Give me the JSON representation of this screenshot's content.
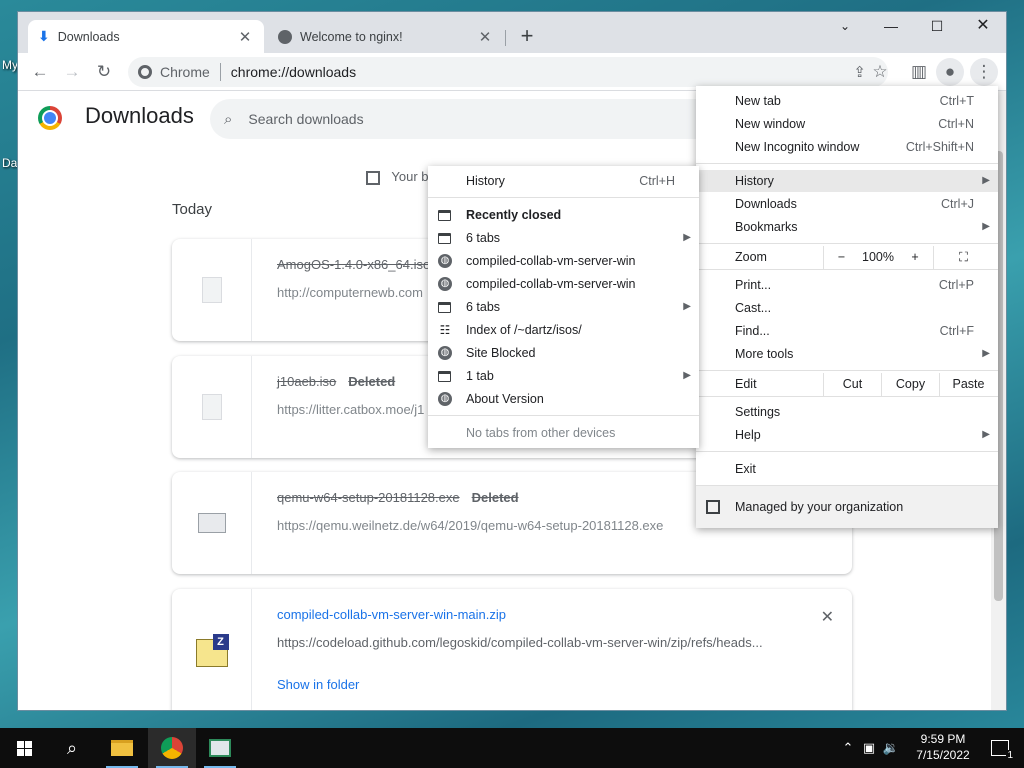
{
  "desktop": {
    "labels": [
      "My",
      "Da"
    ]
  },
  "browser": {
    "tabs": [
      {
        "title": "Downloads",
        "icon": "download-icon",
        "active": true
      },
      {
        "title": "Welcome to nginx!",
        "icon": "globe-icon",
        "active": false
      }
    ],
    "omnibox": {
      "scheme": "Chrome",
      "url": "chrome://downloads"
    }
  },
  "downloads_page": {
    "title": "Downloads",
    "search_placeholder": "Search downloads",
    "managed_notice": "Your b",
    "section_label": "Today",
    "items": [
      {
        "name": "AmogOS-1.4.0-x86_64.iso",
        "status": "",
        "url": "http://computernewb.com",
        "deleted": true
      },
      {
        "name": "j10aeb.iso",
        "status": "Deleted",
        "url": "https://litter.catbox.moe/j1",
        "deleted": true
      },
      {
        "name": "qemu-w64-setup-20181128.exe",
        "status": "Deleted",
        "url": "https://qemu.weilnetz.de/w64/2019/qemu-w64-setup-20181128.exe",
        "deleted": true
      },
      {
        "name": "compiled-collab-vm-server-win-main.zip",
        "status": "",
        "url": "https://codeload.github.com/legoskid/compiled-collab-vm-server-win/zip/refs/heads...",
        "deleted": false,
        "action": "Show in folder"
      }
    ]
  },
  "chrome_menu": {
    "new_tab": {
      "label": "New tab",
      "shortcut": "Ctrl+T"
    },
    "new_window": {
      "label": "New window",
      "shortcut": "Ctrl+N"
    },
    "new_incognito": {
      "label": "New Incognito window",
      "shortcut": "Ctrl+Shift+N"
    },
    "history": {
      "label": "History"
    },
    "downloads": {
      "label": "Downloads",
      "shortcut": "Ctrl+J"
    },
    "bookmarks": {
      "label": "Bookmarks"
    },
    "zoom": {
      "label": "Zoom",
      "minus": "−",
      "value": "100%",
      "plus": "+"
    },
    "print": {
      "label": "Print...",
      "shortcut": "Ctrl+P"
    },
    "cast": {
      "label": "Cast..."
    },
    "find": {
      "label": "Find...",
      "shortcut": "Ctrl+F"
    },
    "more_tools": {
      "label": "More tools"
    },
    "edit": {
      "label": "Edit",
      "cut": "Cut",
      "copy": "Copy",
      "paste": "Paste"
    },
    "settings": {
      "label": "Settings"
    },
    "help": {
      "label": "Help"
    },
    "exit": {
      "label": "Exit"
    },
    "managed": {
      "label": "Managed by your organization"
    }
  },
  "history_submenu": {
    "history": {
      "label": "History",
      "shortcut": "Ctrl+H"
    },
    "recently_closed": "Recently closed",
    "items": [
      {
        "label": "6 tabs",
        "icon": "window-icon",
        "submenu": true
      },
      {
        "label": "compiled-collab-vm-server-win",
        "icon": "globe-icon",
        "submenu": false
      },
      {
        "label": "compiled-collab-vm-server-win",
        "icon": "globe-icon",
        "submenu": false
      },
      {
        "label": "6 tabs",
        "icon": "window-icon",
        "submenu": true
      },
      {
        "label": "Index of /~dartz/isos/",
        "icon": "server-icon",
        "submenu": false
      },
      {
        "label": "Site Blocked",
        "icon": "globe-icon",
        "submenu": false
      },
      {
        "label": "1 tab",
        "icon": "window-icon",
        "submenu": true
      },
      {
        "label": "About Version",
        "icon": "globe-icon",
        "submenu": false
      }
    ],
    "no_tabs": "No tabs from other devices"
  },
  "taskbar": {
    "time": "9:59 PM",
    "date": "7/15/2022",
    "notification_count": "1"
  }
}
